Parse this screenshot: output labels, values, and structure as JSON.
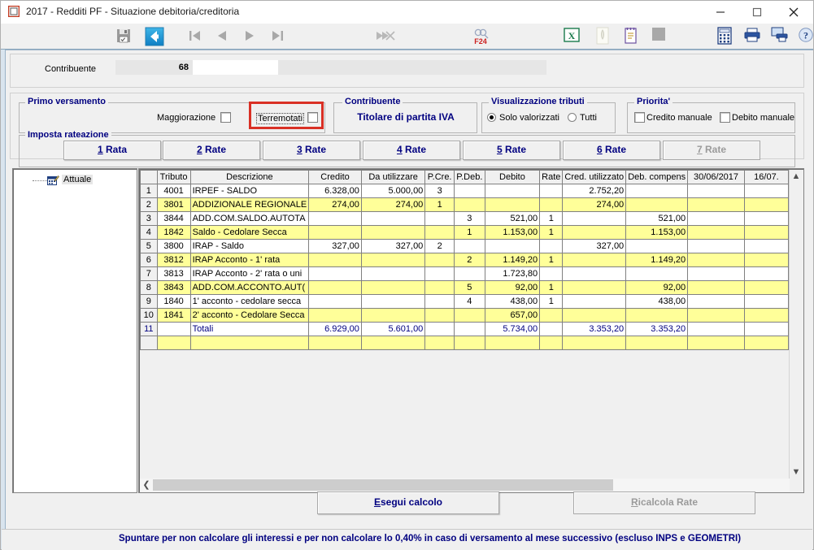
{
  "window": {
    "title": "2017 - Redditi PF - Situazione debitoria/creditoria",
    "icon": "app-window-icon",
    "minimize": "minimize-icon",
    "maximize": "maximize-icon",
    "close": "close-icon"
  },
  "toolbar": {
    "items": [
      {
        "name": "save-icon",
        "title": "Salva"
      },
      {
        "name": "back-arrow-icon",
        "title": "Indietro"
      },
      {
        "name": "first-record-icon",
        "title": "Primo"
      },
      {
        "name": "prev-record-icon",
        "title": "Precedente"
      },
      {
        "name": "next-record-icon",
        "title": "Successivo"
      },
      {
        "name": "last-record-icon",
        "title": "Ultimo"
      },
      {
        "name": "skip-forward-icon",
        "title": "Avanti veloce"
      },
      {
        "name": "f24-icon",
        "title": "F24"
      },
      {
        "name": "excel-export-icon",
        "title": "Esporta Excel"
      },
      {
        "name": "document-icon",
        "title": "Documento"
      },
      {
        "name": "notepad-icon",
        "title": "Note"
      },
      {
        "name": "stop-icon",
        "title": "Stop"
      },
      {
        "name": "calculator-icon",
        "title": "Calcolatrice"
      },
      {
        "name": "print-icon",
        "title": "Stampa"
      },
      {
        "name": "print-preview-icon",
        "title": "Anteprima di stampa"
      },
      {
        "name": "help-icon",
        "title": "Guida"
      }
    ]
  },
  "contribuente": {
    "label": "Contribuente",
    "id": "68",
    "name": "",
    "extra": ""
  },
  "groups": {
    "primo_versamento": {
      "title": "Primo versamento",
      "maggiorazione_label": "Maggiorazione",
      "maggiorazione_checked": false,
      "terremotati_label": "Terremotati",
      "terremotati_checked": false,
      "terremotati_highlight_color": "#d93025"
    },
    "contribuente": {
      "title": "Contribuente",
      "value": "Titolare di partita IVA"
    },
    "visualizzazione_tributi": {
      "title": "Visualizzazione tributi",
      "options": [
        "Solo valorizzati",
        "Tutti"
      ],
      "selected": "Solo valorizzati"
    },
    "priorita": {
      "title": "Priorita'",
      "credito_label": "Credito manuale",
      "credito_checked": false,
      "debito_label": "Debito manuale",
      "debito_checked": false
    },
    "imposta_rateazione": {
      "title": "Imposta rateazione",
      "buttons": [
        {
          "accel": "1",
          "rest": " Rata",
          "disabled": false
        },
        {
          "accel": "2",
          "rest": " Rate",
          "disabled": false
        },
        {
          "accel": "3",
          "rest": " Rate",
          "disabled": false
        },
        {
          "accel": "4",
          "rest": " Rate",
          "disabled": false
        },
        {
          "accel": "5",
          "rest": " Rate",
          "disabled": false
        },
        {
          "accel": "6",
          "rest": " Rate",
          "disabled": false
        },
        {
          "accel": "7",
          "rest": " Rate",
          "disabled": true
        }
      ]
    }
  },
  "tree": {
    "root_label": "Attuale",
    "root_icon": "calendar-edit-icon"
  },
  "grid": {
    "columns": [
      "",
      "Tributo",
      "Descrizione",
      "Credito",
      "Da utilizzare",
      "P.Cre.",
      "P.Deb.",
      "Debito",
      "Rate",
      "Cred. utilizzato",
      "Deb. compens",
      "30/06/2017",
      "16/07."
    ],
    "rows": [
      {
        "n": "1",
        "tributo": "4001",
        "descrizione": "IRPEF - SALDO",
        "credito": "6.328,00",
        "da_utilizzare": "5.000,00",
        "pcre": "3",
        "pdeb": "",
        "debito": "",
        "rate": "",
        "cred_utilizzato": "2.752,20",
        "deb_compens": "",
        "d30062017": "",
        "d1607": ""
      },
      {
        "n": "2",
        "tributo": "3801",
        "descrizione": "ADDIZIONALE REGIONALE",
        "credito": "274,00",
        "da_utilizzare": "274,00",
        "pcre": "1",
        "pdeb": "",
        "debito": "",
        "rate": "",
        "cred_utilizzato": "274,00",
        "deb_compens": "",
        "d30062017": "",
        "d1607": ""
      },
      {
        "n": "3",
        "tributo": "3844",
        "descrizione": "ADD.COM.SALDO.AUTOTA",
        "credito": "",
        "da_utilizzare": "",
        "pcre": "",
        "pdeb": "3",
        "debito": "521,00",
        "rate": "1",
        "cred_utilizzato": "",
        "deb_compens": "521,00",
        "d30062017": "",
        "d1607": ""
      },
      {
        "n": "4",
        "tributo": "1842",
        "descrizione": "Saldo - Cedolare Secca",
        "credito": "",
        "da_utilizzare": "",
        "pcre": "",
        "pdeb": "1",
        "debito": "1.153,00",
        "rate": "1",
        "cred_utilizzato": "",
        "deb_compens": "1.153,00",
        "d30062017": "",
        "d1607": ""
      },
      {
        "n": "5",
        "tributo": "3800",
        "descrizione": "IRAP - Saldo",
        "credito": "327,00",
        "da_utilizzare": "327,00",
        "pcre": "2",
        "pdeb": "",
        "debito": "",
        "rate": "",
        "cred_utilizzato": "327,00",
        "deb_compens": "",
        "d30062017": "",
        "d1607": ""
      },
      {
        "n": "6",
        "tributo": "3812",
        "descrizione": "IRAP Acconto - 1' rata",
        "credito": "",
        "da_utilizzare": "",
        "pcre": "",
        "pdeb": "2",
        "debito": "1.149,20",
        "rate": "1",
        "cred_utilizzato": "",
        "deb_compens": "1.149,20",
        "d30062017": "",
        "d1607": ""
      },
      {
        "n": "7",
        "tributo": "3813",
        "descrizione": "IRAP Acconto - 2' rata o uni",
        "credito": "",
        "da_utilizzare": "",
        "pcre": "",
        "pdeb": "",
        "debito": "1.723,80",
        "rate": "",
        "cred_utilizzato": "",
        "deb_compens": "",
        "d30062017": "",
        "d1607": ""
      },
      {
        "n": "8",
        "tributo": "3843",
        "descrizione": "ADD.COM.ACCONTO.AUT(",
        "credito": "",
        "da_utilizzare": "",
        "pcre": "",
        "pdeb": "5",
        "debito": "92,00",
        "rate": "1",
        "cred_utilizzato": "",
        "deb_compens": "92,00",
        "d30062017": "",
        "d1607": ""
      },
      {
        "n": "9",
        "tributo": "1840",
        "descrizione": "1' acconto - cedolare secca",
        "credito": "",
        "da_utilizzare": "",
        "pcre": "",
        "pdeb": "4",
        "debito": "438,00",
        "rate": "1",
        "cred_utilizzato": "",
        "deb_compens": "438,00",
        "d30062017": "",
        "d1607": ""
      },
      {
        "n": "10",
        "tributo": "1841",
        "descrizione": "2' acconto - Cedolare Secca",
        "credito": "",
        "da_utilizzare": "",
        "pcre": "",
        "pdeb": "",
        "debito": "657,00",
        "rate": "",
        "cred_utilizzato": "",
        "deb_compens": "",
        "d30062017": "",
        "d1607": ""
      },
      {
        "n": "11",
        "tributo": "",
        "descrizione": "Totali",
        "credito": "6.929,00",
        "da_utilizzare": "5.601,00",
        "pcre": "",
        "pdeb": "",
        "debito": "5.734,00",
        "rate": "",
        "cred_utilizzato": "3.353,20",
        "deb_compens": "3.353,20",
        "d30062017": "",
        "d1607": ""
      },
      {
        "n": "",
        "tributo": "",
        "descrizione": "",
        "credito": "",
        "da_utilizzare": "",
        "pcre": "",
        "pdeb": "",
        "debito": "",
        "rate": "",
        "cred_utilizzato": "",
        "deb_compens": "",
        "d30062017": "",
        "d1607": ""
      }
    ]
  },
  "actions": {
    "esegui_accel": "E",
    "esegui_rest": "segui calcolo",
    "ricalcola_accel": "R",
    "ricalcola_rest": "icalcola Rate",
    "ricalcola_disabled": true
  },
  "statusbar": {
    "text": "Spuntare per non calcolare gli interessi e per non calcolare lo 0,40% in caso di versamento al mese successivo (escluso INPS e GEOMETRI)"
  }
}
